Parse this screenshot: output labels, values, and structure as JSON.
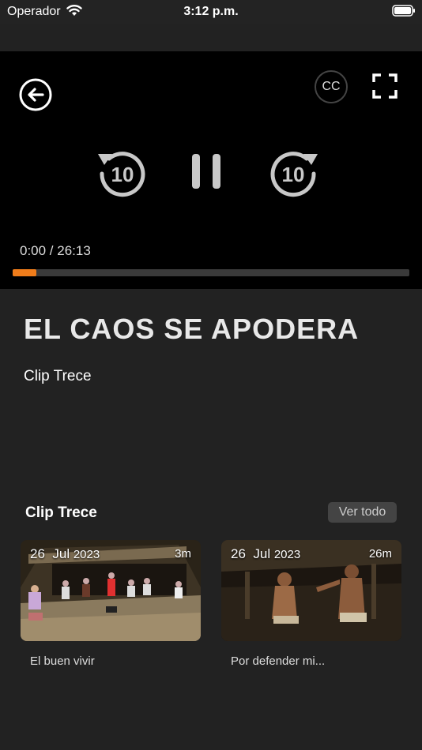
{
  "status_bar": {
    "carrier": "Operador",
    "time": "3:12 p.m."
  },
  "player": {
    "cc_label": "CC",
    "rewind_seconds": "10",
    "forward_seconds": "10",
    "time_readout": "0:00 / 26:13",
    "progress_fraction": 0.06,
    "accent_color": "#f07d1b"
  },
  "video": {
    "title": "EL CAOS SE APODERA",
    "subtitle": "Clip Trece"
  },
  "related": {
    "section_title": "Clip Trece",
    "see_all_label": "Ver todo",
    "items": [
      {
        "day": "26",
        "month": "Jul",
        "year": "2023",
        "duration": "3m",
        "caption": "El buen vivir"
      },
      {
        "day": "26",
        "month": "Jul",
        "year": "2023",
        "duration": "26m",
        "caption": "Por defender mi..."
      }
    ]
  }
}
